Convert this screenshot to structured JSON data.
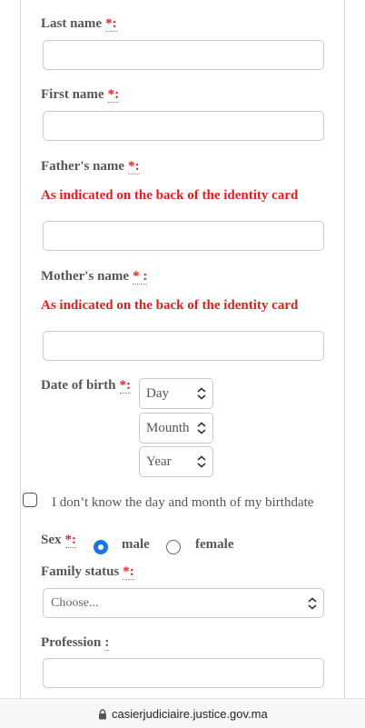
{
  "form": {
    "last_name": {
      "label": "Last name",
      "req": "*:"
    },
    "first_name": {
      "label": "First name",
      "req": "*:"
    },
    "father_name": {
      "label": "Father's name",
      "req": "*:",
      "note": "As indicated on the back of the identity card"
    },
    "mother_name": {
      "label": "Mother's name",
      "req": "* :",
      "note": "As indicated on the back of the identity card"
    },
    "dob": {
      "label": "Date of birth",
      "req": "*:",
      "day": "Day",
      "month": "Mounth",
      "year": "Year"
    },
    "unknown_date": {
      "label": "I don’t know the day and month of my birthdate",
      "checked": false
    },
    "sex": {
      "label": "Sex",
      "req": "*:",
      "male": "male",
      "female": "female",
      "selected": "male"
    },
    "family_status": {
      "label": "Family status",
      "req": "*:",
      "placeholder": "Choose..."
    },
    "profession": {
      "label": "Profession",
      "req": ":"
    }
  },
  "browser": {
    "url": "casierjudiciaire.justice.gov.ma",
    "lock_icon": "lock-icon"
  },
  "colors": {
    "required": "#e02020",
    "radio_selected": "#1a73e8"
  }
}
